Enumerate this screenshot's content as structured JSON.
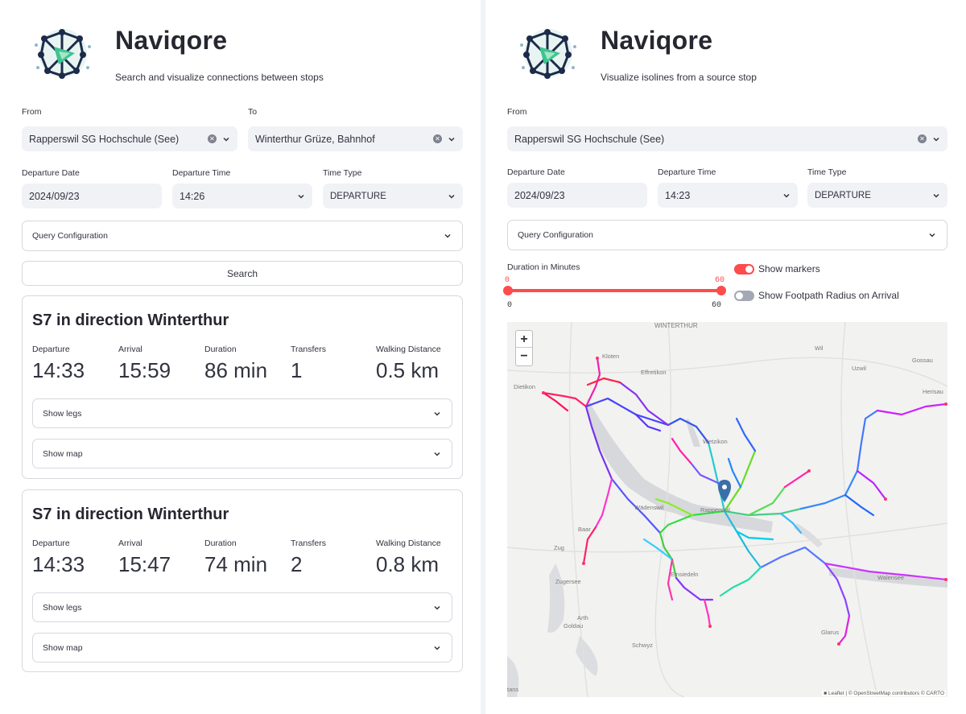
{
  "left": {
    "app_title": "Naviqore",
    "subtitle": "Search and visualize connections between stops",
    "from_label": "From",
    "from_value": "Rapperswil SG Hochschule (See)",
    "to_label": "To",
    "to_value": "Winterthur Grüze, Bahnhof",
    "date_label": "Departure Date",
    "date_value": "2024/09/23",
    "time_label": "Departure Time",
    "time_value": "14:26",
    "type_label": "Time Type",
    "type_value": "DEPARTURE",
    "query_config": "Query Configuration",
    "search_button": "Search",
    "metric_labels": {
      "departure": "Departure",
      "arrival": "Arrival",
      "duration": "Duration",
      "transfers": "Transfers",
      "walking": "Walking Distance"
    },
    "results": [
      {
        "title": "S7 in direction Winterthur",
        "departure": "14:33",
        "arrival": "15:59",
        "duration": "86 min",
        "transfers": "1",
        "walking": "0.5 km",
        "show_legs": "Show legs",
        "show_map": "Show map"
      },
      {
        "title": "S7 in direction Winterthur",
        "departure": "14:33",
        "arrival": "15:47",
        "duration": "74 min",
        "transfers": "2",
        "walking": "0.8 km",
        "show_legs": "Show legs",
        "show_map": "Show map"
      }
    ]
  },
  "right": {
    "app_title": "Naviqore",
    "subtitle": "Visualize isolines from a source stop",
    "from_label": "From",
    "from_value": "Rapperswil SG Hochschule (See)",
    "date_label": "Departure Date",
    "date_value": "2024/09/23",
    "time_label": "Departure Time",
    "time_value": "14:23",
    "type_label": "Time Type",
    "type_value": "DEPARTURE",
    "query_config": "Query Configuration",
    "duration_label": "Duration in Minutes",
    "slider": {
      "min": "0",
      "max": "60",
      "low": "0",
      "high": "60"
    },
    "show_markers": {
      "label": "Show markers",
      "on": true
    },
    "show_footpath": {
      "label": "Show Footpath Radius on Arrival",
      "on": false
    },
    "map": {
      "zoom_in": "+",
      "zoom_out": "−",
      "attribution": "■ Leaflet | © OpenStreetMap contributors © CARTO",
      "places": [
        "WINTERTHUR",
        "Kloten",
        "Effretikon",
        "Wil",
        "Uzwil",
        "Gossau",
        "Herisau",
        "Dietikon",
        "Wetzikon",
        "Wädenswil",
        "Rapperswil",
        "Baar",
        "Zug",
        "Einsiedeln",
        "Zugersee",
        "Arth",
        "Goldau",
        "Schwyz",
        "Walensee",
        "Glarus",
        "tans"
      ]
    },
    "colors": {
      "accent": "#ff4b4b",
      "toggle_off": "#a3a8b4"
    }
  }
}
